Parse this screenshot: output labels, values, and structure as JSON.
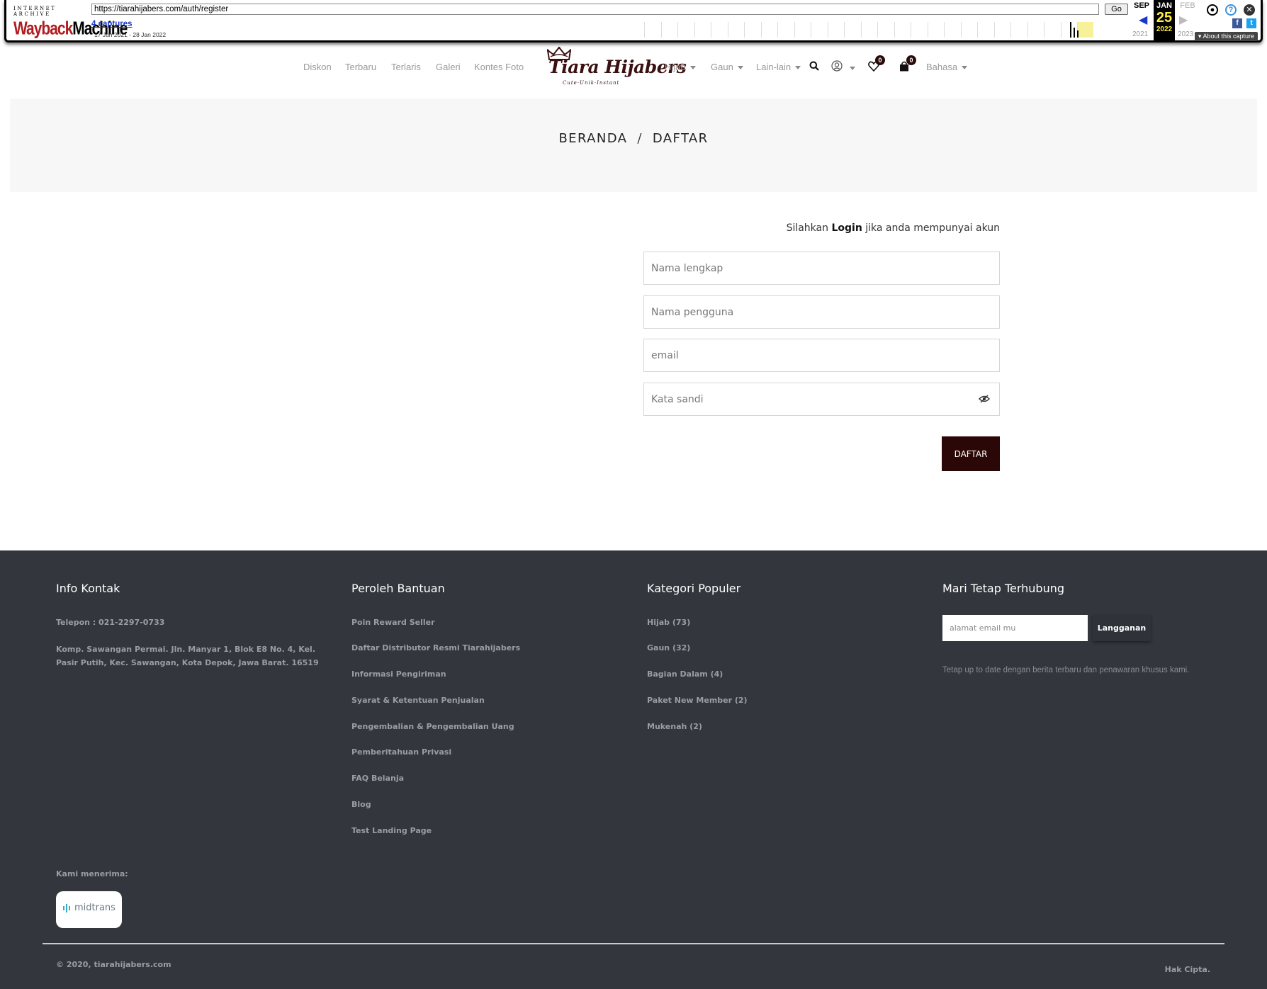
{
  "wayback": {
    "logo_top": "INTERNET ARCHIVE",
    "logo_way": "Wayback",
    "logo_machine": "Machine",
    "url": "https://tiarahijabers.com/auth/register",
    "go_label": "Go",
    "captures_label": "4 captures",
    "date_range": "17 Jun 2021 - 28 Jan 2022",
    "prev_month": "SEP",
    "current_month": "JAN",
    "current_day": "25",
    "current_year": "2022",
    "next_month": "FEB",
    "prev_year": "2021",
    "next_year": "2023",
    "about_label": "About this capture"
  },
  "nav": {
    "left_items": [
      "Diskon",
      "Terbaru",
      "Terlaris",
      "Galeri",
      "Kontes Foto"
    ],
    "brand_name": "Tiara Hijabers",
    "brand_tagline": "Cute·Unik·Instant",
    "right_items": [
      "Hijab",
      "Gaun",
      "Lain-lain"
    ],
    "wishlist_count": "0",
    "cart_count": "0",
    "language_label": "Bahasa"
  },
  "breadcrumb": {
    "home": "BERANDA",
    "separator": "/",
    "current": "DAFTAR"
  },
  "register": {
    "login_prompt_before": "Silahkan",
    "login_link": "Login",
    "login_prompt_after": "jika anda mempunyai akun",
    "fullname_placeholder": "Nama lengkap",
    "username_placeholder": "Nama pengguna",
    "email_placeholder": "email",
    "password_placeholder": "Kata sandi",
    "submit_label": "DAFTAR"
  },
  "footer": {
    "contact": {
      "heading": "Info Kontak",
      "phone": "Telepon : 021-2297-0733",
      "address": "Komp. Sawangan Permai. Jln. Manyar 1, Blok E8 No. 4, Kel. Pasir Putih, Kec. Sawangan, Kota Depok, Jawa Barat. 16519"
    },
    "help": {
      "heading": "Peroleh Bantuan",
      "links": [
        "Poin Reward Seller",
        "Daftar Distributor Resmi Tiarahijabers",
        "Informasi Pengiriman",
        "Syarat & Ketentuan Penjualan",
        "Pengembalian & Pengembalian Uang",
        "Pemberitahuan Privasi",
        "FAQ Belanja",
        "Blog",
        "Test Landing Page"
      ]
    },
    "categories": {
      "heading": "Kategori Populer",
      "links": [
        "Hijab (73)",
        "Gaun (32)",
        "Bagian Dalam (4)",
        "Paket New Member (2)",
        "Mukenah (2)"
      ]
    },
    "newsletter": {
      "heading": "Mari Tetap Terhubung",
      "placeholder": "alamat email mu",
      "button_label": "Langganan",
      "note": "Tetap up to date dengan berita terbaru dan penawaran khusus kami."
    },
    "accept_label": "Kami menerima:",
    "payment_name": "midtrans",
    "copyright": "© 2020, tiarahijabers.com",
    "rights": "Hak Cipta."
  },
  "colors": {
    "brand_dark": "#2c0707",
    "footer_bg": "#33363d",
    "banner_bg": "#f7f7f7"
  }
}
